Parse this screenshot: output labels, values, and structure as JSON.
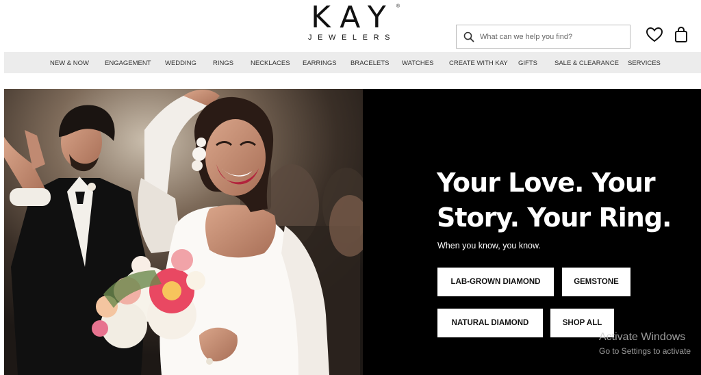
{
  "header": {
    "logo_main": "KAY",
    "logo_sub": "JEWELERS",
    "logo_mark": "®",
    "search_placeholder": "What can we help you find?",
    "icons": [
      "search-icon",
      "heart-icon",
      "shopping-bag-icon"
    ]
  },
  "nav": {
    "items": [
      {
        "label": "NEW & NOW"
      },
      {
        "label": "ENGAGEMENT"
      },
      {
        "label": "WEDDING"
      },
      {
        "label": "RINGS"
      },
      {
        "label": "NECKLACES"
      },
      {
        "label": "EARRINGS"
      },
      {
        "label": "BRACELETS"
      },
      {
        "label": "WATCHES"
      },
      {
        "label": "CREATE WITH KAY"
      },
      {
        "label": "GIFTS"
      },
      {
        "label": "SALE & CLEARANCE"
      },
      {
        "label": "SERVICES"
      }
    ]
  },
  "hero": {
    "headline": "Your Love. Your Story. Your Ring.",
    "subline": "When you know, you know.",
    "buttons": {
      "lab": "LAB-GROWN DIAMOND",
      "gem": "GEMSTONE",
      "natural": "NATURAL DIAMOND",
      "all": "SHOP ALL"
    }
  },
  "watermark": {
    "title": "Activate Windows",
    "subtitle": "Go to Settings to activate"
  },
  "colors": {
    "nav_bg": "#ececec",
    "hero_bg": "#000000",
    "button_bg": "#ffffff",
    "text_dark": "#111111"
  }
}
